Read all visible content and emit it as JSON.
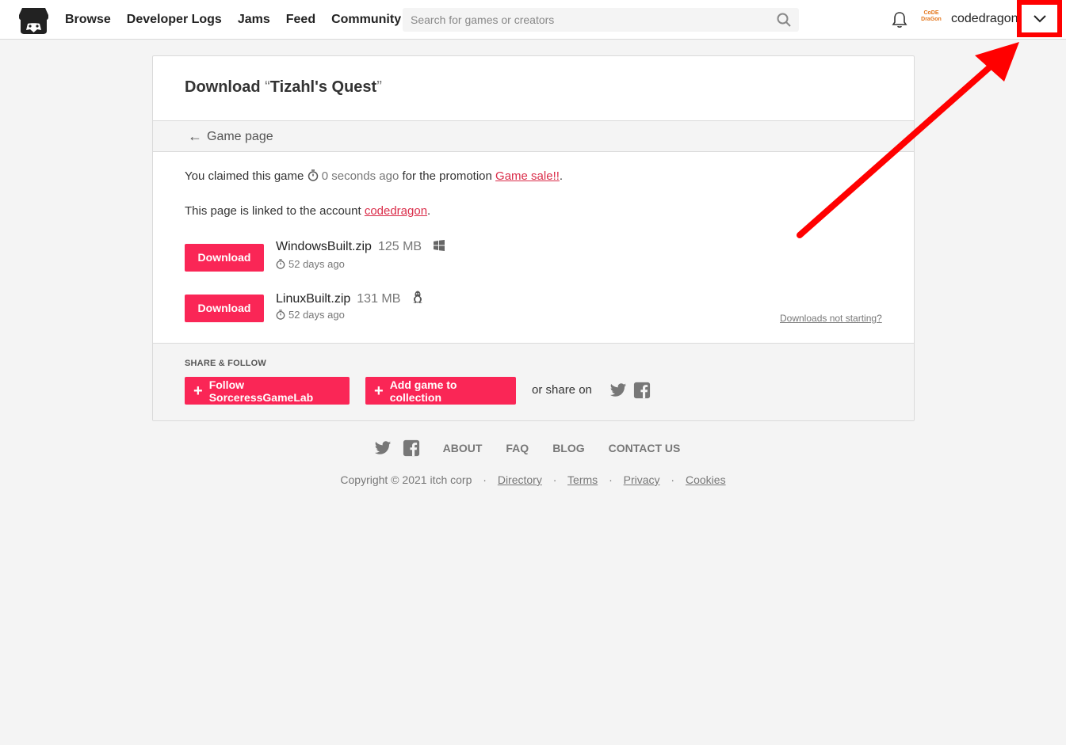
{
  "header": {
    "nav": [
      "Browse",
      "Developer Logs",
      "Jams",
      "Feed",
      "Community"
    ],
    "search_placeholder": "Search for games or creators",
    "username": "codedragon",
    "avatar_text": "CoDE DraGon"
  },
  "card": {
    "title_prefix": "Download ",
    "open_quote": "“",
    "game_title": "Tizahl's Quest",
    "close_quote": "”",
    "back_link": "Game page",
    "claim_prefix": "You claimed this game",
    "claim_time": "0 seconds ago",
    "claim_middle": "for the promotion",
    "promotion": "Game sale!!",
    "claim_suffix": ".",
    "linked_prefix": "This page is linked to the account",
    "linked_account": "codedragon",
    "linked_suffix": ".",
    "download_label": "Download",
    "files": [
      {
        "name": "WindowsBuilt.zip",
        "size": "125 MB",
        "os": "windows-icon",
        "date": "52 days ago"
      },
      {
        "name": "LinuxBuilt.zip",
        "size": "131 MB",
        "os": "linux-icon",
        "date": "52 days ago"
      }
    ],
    "not_starting": "Downloads not starting?"
  },
  "share": {
    "label": "SHARE & FOLLOW",
    "follow": "Follow SorceressGameLab",
    "collection": "Add game to collection",
    "or_share": "or share on"
  },
  "footer": {
    "links": [
      "ABOUT",
      "FAQ",
      "BLOG",
      "CONTACT US"
    ],
    "copyright": "Copyright © 2021 itch corp",
    "legal": [
      "Directory",
      "Terms",
      "Privacy",
      "Cookies"
    ]
  },
  "colors": {
    "accent": "#fa2656",
    "link": "#da2c49",
    "annotation": "#ff0000"
  }
}
